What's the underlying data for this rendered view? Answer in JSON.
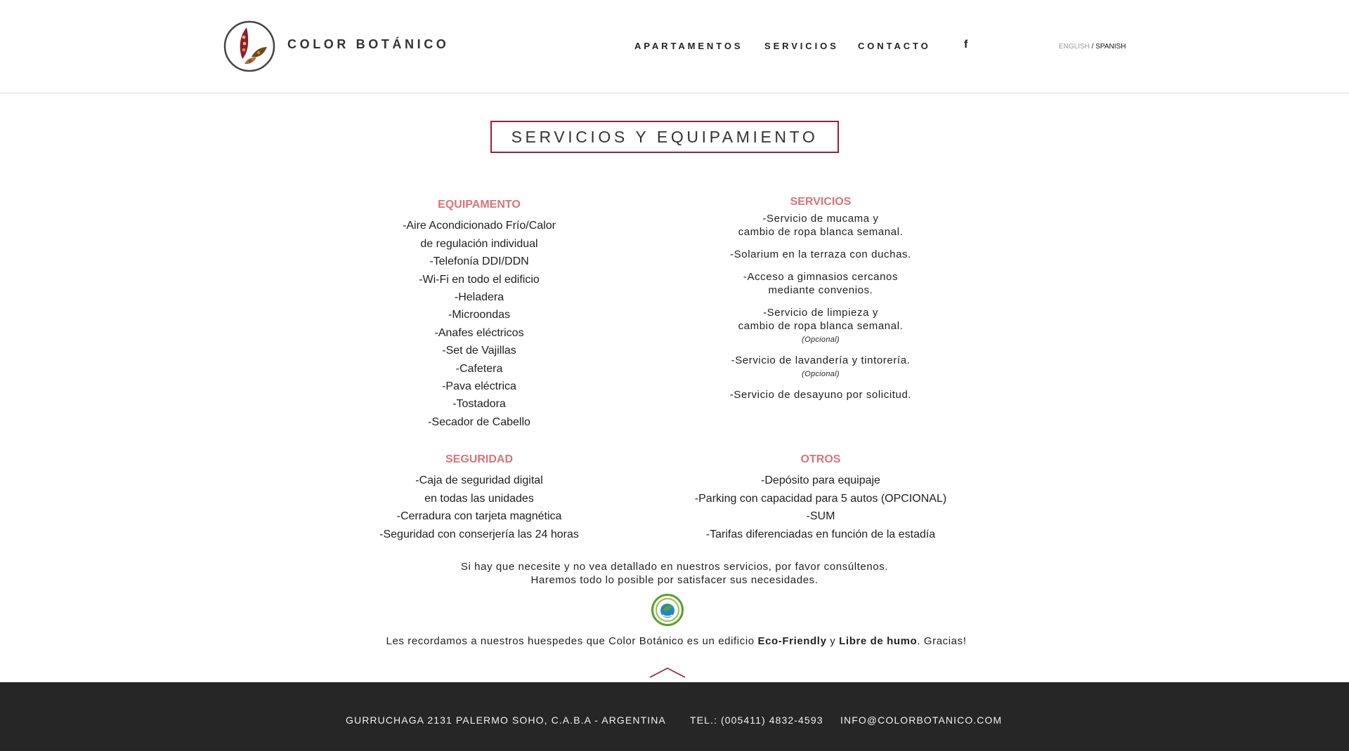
{
  "header": {
    "brand": "COLOR BOTÁNICO",
    "logo_icon": "leaf-seeds-icon",
    "nav": [
      "APARTAMENTOS",
      "SERVICIOS",
      "CONTACTO"
    ],
    "facebook_icon": "f",
    "lang": {
      "english": "ENGLISH",
      "separator": " / ",
      "spanish": "SPANISH"
    }
  },
  "title": "SERVICIOS Y EQUIPAMIENTO",
  "equipamiento": {
    "heading": "EQUIPAMENTO",
    "items": [
      "-Aire Acondicionado Frío/Calor",
      "de regulación individual",
      "-Telefonía DDI/DDN",
      "-Wi-Fi en todo el edificio",
      "-Heladera",
      "-Microondas",
      "-Anafes eléctricos",
      "-Set de Vajillas",
      "-Cafetera",
      "-Pava eléctrica",
      "-Tostadora",
      "-Secador de Cabello"
    ]
  },
  "servicios": {
    "heading": "SERVICIOS",
    "items": [
      {
        "line1": "-Servicio de mucama y",
        "line2": "cambio de ropa blanca semanal.",
        "note": ""
      },
      {
        "line1": "-Solarium en la terraza con duchas.",
        "line2": "",
        "note": ""
      },
      {
        "line1": "-Acceso a gimnasios cercanos",
        "line2": "mediante convenios.",
        "note": ""
      },
      {
        "line1": "-Servicio de limpieza y",
        "line2": "cambio de ropa blanca semanal.",
        "note": "(Opcional)"
      },
      {
        "line1": "-Servicio de lavandería y tintorería.",
        "line2": "",
        "note": "(Opcional)"
      },
      {
        "line1": "-Servicio de desayuno por solicitud.",
        "line2": "",
        "note": ""
      }
    ]
  },
  "seguridad": {
    "heading": "SEGURIDAD",
    "items": [
      "-Caja de seguridad digital",
      "en todas las unidades",
      "-Cerradura con tarjeta magnética",
      "-Seguridad con conserjería las 24 horas"
    ]
  },
  "otros": {
    "heading": "OTROS",
    "items": [
      "-Depósito para equipaje",
      "-Parking con capacidad para 5 autos (OPCIONAL)",
      "-SUM",
      "-Tarifas diferenciadas en función de la estadía"
    ]
  },
  "note": {
    "line1": "Si hay que necesite y no vea detallado en nuestros servicios, por favor consúltenos.",
    "line2": "Haremos todo lo posible por satisfacer sus necesidades."
  },
  "eco_icon": "eco-friendly-badge-icon",
  "reminder": {
    "pre": "Les recordamos a nuestros huespedes que Color Botánico es un edificio ",
    "bold1": "Eco-Friendly",
    "mid": " y ",
    "bold2": "Libre de humo",
    "post": ". Gracias!"
  },
  "footer": {
    "address": "GURRUCHAGA 2131  PALERMO SOHO, C.A.B.A  - ARGENTINA",
    "tel": "TEL.: (005411) 4832-4593",
    "email": "INFO@COLORBOTANICO.COM"
  },
  "colors": {
    "accent": "#9b1e3c",
    "section_heading": "#d9737b",
    "footer_bg": "#262626",
    "eco_green": "#5aa02c",
    "eco_blue": "#1f87c6"
  }
}
